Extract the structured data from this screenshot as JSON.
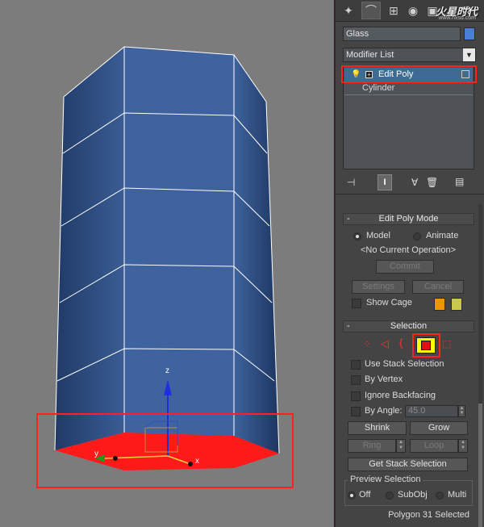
{
  "command_panel": {
    "tabs": [
      "create-icon",
      "modify-icon",
      "hierarchy-icon",
      "motion-icon",
      "display-icon",
      "utilities-icon"
    ],
    "watermark": "火星时代",
    "watermark_url": "www.hxsd.com"
  },
  "object": {
    "name": "Glass",
    "color": "#4a7fd6"
  },
  "modifier_list": {
    "label": "Modifier List"
  },
  "modifier_stack": {
    "items": [
      {
        "label": "Edit Poly",
        "selected": true
      },
      {
        "label": "Cylinder",
        "selected": false
      }
    ]
  },
  "edit_poly_mode": {
    "title": "Edit Poly Mode",
    "minus": "-",
    "model_label": "Model",
    "animate_label": "Animate",
    "mode_selected": "Model",
    "current_operation": "<No Current Operation>",
    "commit_label": "Commit",
    "settings_label": "Settings",
    "cancel_label": "Cancel",
    "show_cage_label": "Show Cage",
    "cage_colors": [
      "#f29400",
      "#c8c84a"
    ]
  },
  "selection": {
    "title": "Selection",
    "minus": "-",
    "subobject_modes": [
      "vertex-icon",
      "edge-icon",
      "border-icon",
      "polygon-icon",
      "element-icon"
    ],
    "active_mode": "polygon-icon",
    "use_stack_selection_label": "Use Stack Selection",
    "by_vertex_label": "By Vertex",
    "ignore_backfacing_label": "Ignore Backfacing",
    "by_angle_label": "By Angle:",
    "by_angle_value": "45.0",
    "shrink_label": "Shrink",
    "grow_label": "Grow",
    "ring_label": "Ring",
    "loop_label": "Loop",
    "get_stack_selection_label": "Get Stack Selection",
    "preview_selection_label": "Preview Selection",
    "preview_options": [
      "Off",
      "SubObj",
      "Multi"
    ],
    "preview_selected": "Off",
    "status": "Polygon 31 Selected"
  },
  "viewport": {
    "gizmo_axes": [
      "z",
      "y",
      "x"
    ],
    "object_color": "#2e4f86",
    "selected_face_color": "#ff1a1a"
  }
}
